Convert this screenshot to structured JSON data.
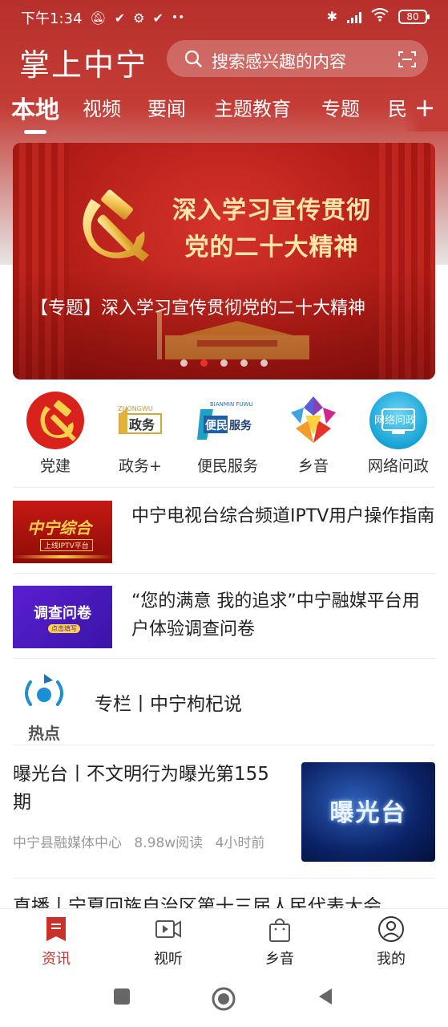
{
  "status": {
    "time": "下午1:34",
    "battery": "80"
  },
  "header": {
    "app_title": "掌上中宁",
    "search_placeholder": "搜索感兴趣的内容"
  },
  "tabs": [
    {
      "label": "本地",
      "active": true
    },
    {
      "label": "视频"
    },
    {
      "label": "要闻"
    },
    {
      "label": "主题教育"
    },
    {
      "label": "专题"
    },
    {
      "label": "民"
    }
  ],
  "banner": {
    "headline_line1": "深入学习宣传贯彻",
    "headline_line2": "党的二十大精神",
    "caption": "【专题】深入学习宣传贯彻党的二十大精神",
    "dot_count": 5,
    "active_dot": 2
  },
  "quick_links": [
    {
      "label": "党建",
      "icon": "party-emblem-icon"
    },
    {
      "label": "政务+",
      "icon": "government-affairs-icon"
    },
    {
      "label": "便民服务",
      "icon": "convenience-service-icon"
    },
    {
      "label": "乡音",
      "icon": "hometown-voice-icon"
    },
    {
      "label": "网络问政",
      "icon": "online-inquiry-icon"
    }
  ],
  "news": [
    {
      "title": "中宁电视台综合频道IPTV用户操作指南",
      "thumb_text": "中宁综合",
      "thumb_sub": "上线IPTV平台"
    },
    {
      "title": "“您的满意 我的追求”中宁融媒平台用户体验调查问卷",
      "thumb_text": "调查问卷",
      "thumb_sub": "点击填写"
    }
  ],
  "hot": {
    "logo_text": "热点",
    "title": "专栏丨中宁枸杞说"
  },
  "feature": {
    "title": "曝光台丨不文明行为曝光第155期",
    "source": "中宁县融媒体中心",
    "reads": "8.98w阅读",
    "time": "4小时前",
    "thumb_text": "曝光台"
  },
  "peek": {
    "title": "直播丨宁夏回族自治区第十三届人民代表大会"
  },
  "bottom_nav": [
    {
      "label": "资讯",
      "icon": "news-icon",
      "active": true
    },
    {
      "label": "视听",
      "icon": "video-icon"
    },
    {
      "label": "乡音",
      "icon": "shopping-bag-icon"
    },
    {
      "label": "我的",
      "icon": "profile-icon"
    }
  ],
  "colors": {
    "brand_red": "#c8322b",
    "header_red": "#b8302b"
  }
}
